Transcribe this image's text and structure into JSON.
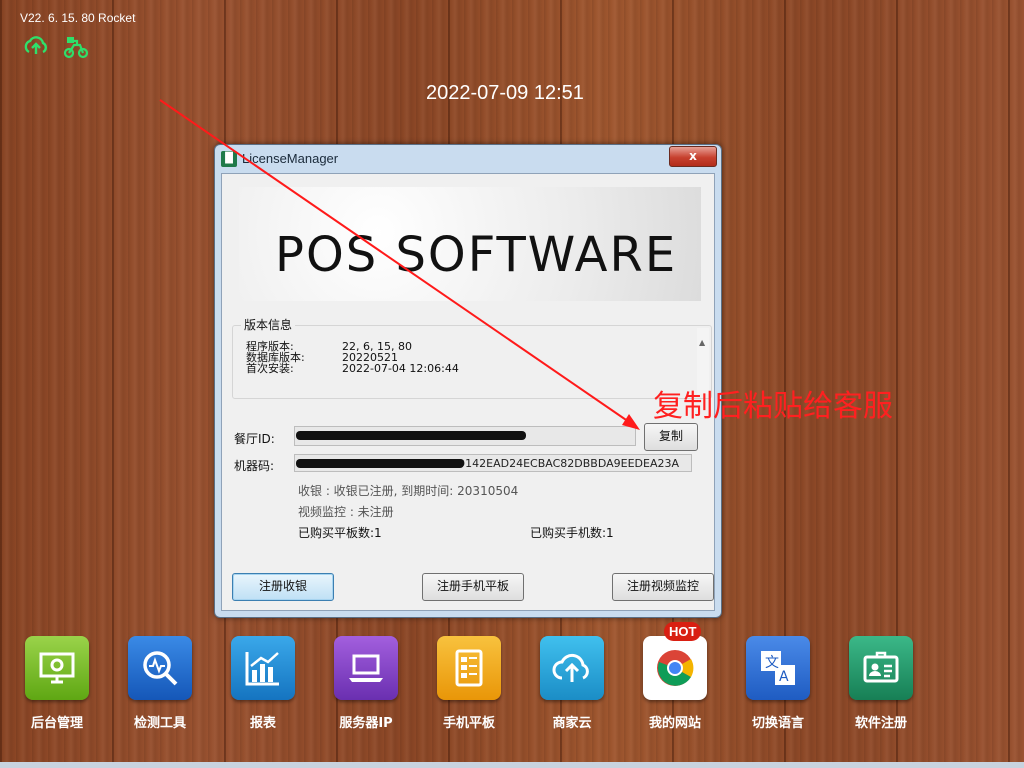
{
  "version": "V22. 6. 15. 80 Rocket",
  "top_icons": [
    "cloud-upload-icon",
    "delivery-bike-icon"
  ],
  "clock": "2022-07-09 12:51",
  "window": {
    "title": "LicenseManager",
    "close_label": "x",
    "banner": "POS SOFTWARE",
    "version_group": {
      "label": "版本信息",
      "rows": [
        {
          "key": "程序版本:",
          "value": "22, 6, 15, 80"
        },
        {
          "key": "数据库版本:",
          "value": "20220521"
        },
        {
          "key": "首次安装:",
          "value": "2022-07-04 12:06:44"
        }
      ]
    },
    "restaurant_id_label": "餐厅ID:",
    "restaurant_id_value": "",
    "copy_button": "复制",
    "machine_code_label": "机器码:",
    "machine_code_value": "EF0EF0CA442D142EAD24ECBAC82DBBDA9EEDEA23A",
    "status": {
      "cashier": "收银 : 收银已注册, 到期时间: 20310504",
      "video": "视频监控 : 未注册",
      "tablets": "已购买平板数:1",
      "phones": "已购买手机数:1"
    },
    "buttons": {
      "register_cashier": "注册收银",
      "register_tablet": "注册手机平板",
      "register_video": "注册视频监控"
    }
  },
  "annotation": "复制后粘贴给客服",
  "dock": [
    {
      "label": "后台管理",
      "icon": "settings-monitor-icon",
      "color": "#7cc11f"
    },
    {
      "label": "检测工具",
      "icon": "search-diagnostic-icon",
      "color": "#1f6fd6"
    },
    {
      "label": "报表",
      "icon": "chart-icon",
      "color": "#1d8fd6"
    },
    {
      "label": "服务器IP",
      "icon": "laptop-icon",
      "color": "#8a44c8"
    },
    {
      "label": "手机平板",
      "icon": "tablet-icon",
      "color": "#f0a91b"
    },
    {
      "label": "商家云",
      "icon": "cloud-upload-icon",
      "color": "#1ea6d9"
    },
    {
      "label": "我的网站",
      "icon": "chrome-icon",
      "color": "#ffffff",
      "badge": "HOT"
    },
    {
      "label": "切换语言",
      "icon": "translate-icon",
      "color": "#2f6fd8"
    },
    {
      "label": "软件注册",
      "icon": "id-card-icon",
      "color": "#1f9a6a"
    }
  ]
}
